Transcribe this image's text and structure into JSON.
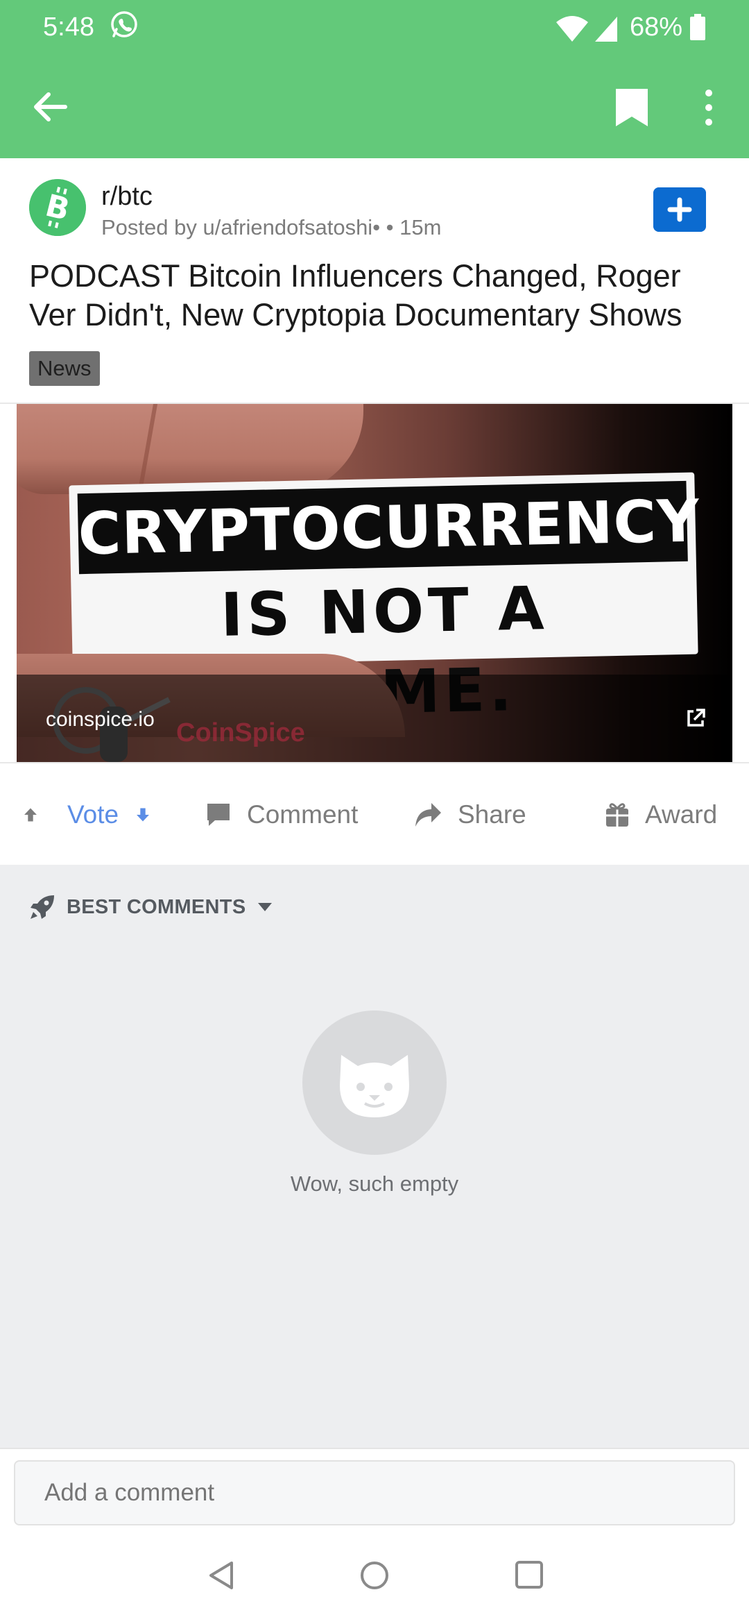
{
  "status_bar": {
    "time": "5:48",
    "battery": "68%"
  },
  "app_bar": {
    "icons": [
      "back-arrow-icon",
      "bookmark-icon",
      "more-vertical-icon"
    ]
  },
  "post": {
    "subreddit": "r/btc",
    "meta": "Posted by u/afriendofsatoshi•  • 15m",
    "title": "PODCAST Bitcoin Influencers Changed, Roger Ver Didn't, New Cryptopia Documentary Shows",
    "flair": "News",
    "media": {
      "sign_line_1": "CRYPTOCURRENCY",
      "sign_line_2": "IS NOT A CRIME.",
      "watermark": "CoinSpice",
      "domain": "coinspice.io"
    }
  },
  "actions": {
    "vote": "Vote",
    "comment": "Comment",
    "share": "Share",
    "award": "Award"
  },
  "comments": {
    "sort_label": "BEST COMMENTS",
    "empty_message": "Wow, such empty"
  },
  "composer": {
    "placeholder": "Add a comment"
  },
  "colors": {
    "app_bar": "#63c97a",
    "accent_blue": "#0c6bd0",
    "vote_blue": "#5b8de6",
    "comments_bg": "#edeef0"
  }
}
